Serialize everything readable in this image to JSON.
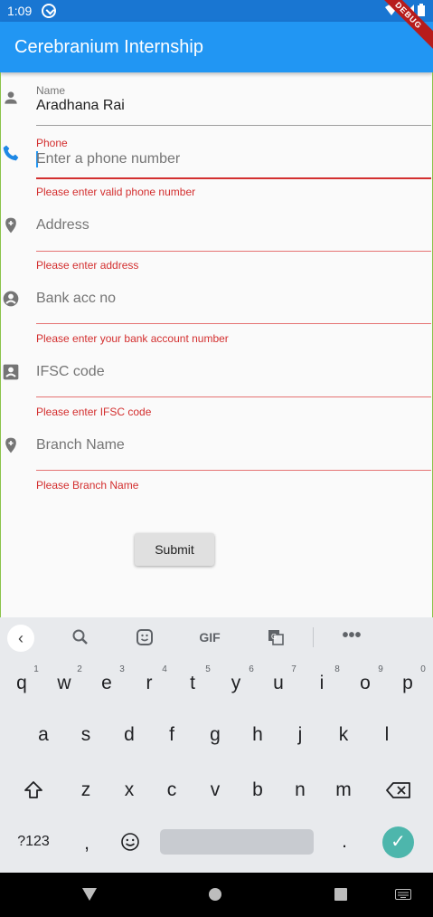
{
  "status_bar": {
    "time": "1:09"
  },
  "app_bar": {
    "title": "Cerebranium Internship",
    "debug_banner": "DEBUG"
  },
  "form": {
    "name": {
      "label": "Name",
      "value": "Aradhana Rai"
    },
    "phone": {
      "label": "Phone",
      "placeholder": "Enter a phone number",
      "error": "Please enter valid phone number"
    },
    "address": {
      "placeholder": "Address",
      "error": "Please enter address"
    },
    "bank": {
      "placeholder": "Bank acc no",
      "error": "Please enter your bank account number"
    },
    "ifsc": {
      "placeholder": "IFSC code",
      "error": "Please enter IFSC code"
    },
    "branch": {
      "placeholder": "Branch Name",
      "error": "Please Branch Name"
    },
    "submit_label": "Submit"
  },
  "keyboard": {
    "gif_label": "GIF",
    "row1": [
      "q",
      "w",
      "e",
      "r",
      "t",
      "y",
      "u",
      "i",
      "o",
      "p"
    ],
    "row1_hints": [
      "1",
      "2",
      "3",
      "4",
      "5",
      "6",
      "7",
      "8",
      "9",
      "0"
    ],
    "row2": [
      "a",
      "s",
      "d",
      "f",
      "g",
      "h",
      "j",
      "k",
      "l"
    ],
    "row3": [
      "z",
      "x",
      "c",
      "v",
      "b",
      "n",
      "m"
    ],
    "symbols_label": "?123",
    "comma": ",",
    "period": "."
  },
  "colors": {
    "primary": "#2196f3",
    "status": "#1976d2",
    "error": "#d32f2f",
    "accent": "#4db6ac"
  }
}
